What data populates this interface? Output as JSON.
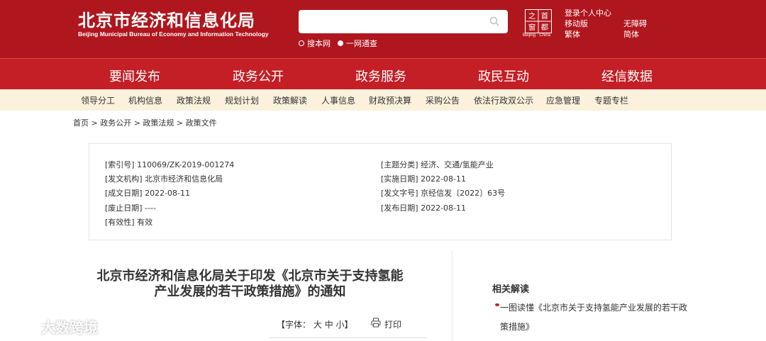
{
  "header": {
    "logo_cn": "北京市经济和信息化局",
    "logo_en": "Beijing Municipal Bureau of Economy and Information Technology",
    "search": {
      "placeholder": "",
      "options": [
        "搜本网",
        "一网通查"
      ]
    },
    "seal_en": "Beijing · China",
    "links_left": [
      "登录个人中心",
      "移动版",
      "繁体"
    ],
    "links_right": [
      "无障碍",
      "简体"
    ]
  },
  "mainnav": [
    "要闻发布",
    "政务公开",
    "政务服务",
    "政民互动",
    "经信数据"
  ],
  "subnav": [
    "领导分工",
    "机构信息",
    "政策法规",
    "规划计划",
    "政策解读",
    "人事信息",
    "财政预决算",
    "采购公告",
    "依法行政双公示",
    "应急管理",
    "专题专栏"
  ],
  "breadcrumb": "首页 > 政务公开 > 政策法规 > 政策文件",
  "info": {
    "left": [
      {
        "label": "[索引号]",
        "value": "110069/ZK-2019-001274"
      },
      {
        "label": "[发文机构]",
        "value": "北京市经济和信息化局"
      },
      {
        "label": "[成文日期]",
        "value": "2022-08-11"
      },
      {
        "label": "[废止日期]",
        "value": "----"
      },
      {
        "label": "[有效性]",
        "value": "有效"
      }
    ],
    "right": [
      {
        "label": "[主题分类]",
        "value": "经济、交通/氢能产业"
      },
      {
        "label": "[实施日期]",
        "value": "2022-08-11"
      },
      {
        "label": "[发文字号]",
        "value": "京经信发〔2022〕63号"
      },
      {
        "label": "[发布日期]",
        "value": "2022-08-11"
      }
    ]
  },
  "article": {
    "title_line1": "北京市经济和信息化局关于印发《北京市关于支持氢能",
    "title_line2": "产业发展的若干政策措施》的通知",
    "font_label": "【字体：",
    "font_sizes": [
      "大",
      "中",
      "小"
    ],
    "font_close": "】",
    "print_label": "打印"
  },
  "related": {
    "title": "相关解读",
    "item": "一图读懂《北京市关于支持氢能产业发展的若干政策措施》"
  },
  "watermark": "大数跨境",
  "colors": {
    "brand_red": "#b0161e",
    "nav_red": "#c41f26",
    "subnav_bg": "#fbf1dc"
  }
}
